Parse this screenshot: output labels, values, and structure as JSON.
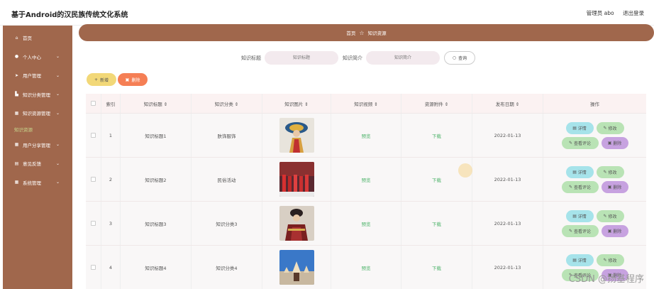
{
  "app": {
    "title": "基于Android的汉民族传统文化系统"
  },
  "user": {
    "role": "管理员 abo",
    "logout": "退出登录"
  },
  "sidebar": {
    "items": [
      {
        "label": "首页",
        "icon": "home-icon"
      },
      {
        "label": "个人中心",
        "icon": "user-icon",
        "chevron": "⌄"
      },
      {
        "label": "用户管理",
        "icon": "send-icon",
        "chevron": "⌄"
      },
      {
        "label": "知识分类管理",
        "icon": "chart-icon",
        "chevron": "⌄"
      },
      {
        "label": "知识资源管理",
        "icon": "grid-icon",
        "chevron": "⌄"
      },
      {
        "label": "知识资源",
        "icon": "",
        "active": true
      },
      {
        "label": "用户分享管理",
        "icon": "grid-icon",
        "chevron": "⌄"
      },
      {
        "label": "意见反馈",
        "icon": "doc-icon",
        "chevron": "⌄"
      },
      {
        "label": "系统管理",
        "icon": "grid-icon",
        "chevron": "⌄"
      }
    ]
  },
  "breadcrumb": {
    "home": "首页",
    "current": "知识资源"
  },
  "search": {
    "title_label": "知识标题",
    "title_placeholder": "知识标题",
    "intro_label": "知识简介",
    "intro_placeholder": "知识简介",
    "button": "查询"
  },
  "toolbar": {
    "add": "新增",
    "delete": "删除"
  },
  "table": {
    "headers": [
      "",
      "索引",
      "知识标题 ⇕",
      "知识分类 ⇕",
      "知识图片 ⇕",
      "知识视频 ⇕",
      "资源附件 ⇕",
      "发布日期 ⇕",
      "操作"
    ],
    "rows": [
      {
        "index": "1",
        "title": "知识标题1",
        "category": "肤饰服饰",
        "video": "预览",
        "attachment": "下载",
        "date": "2022-01-13",
        "ops": [
          "详情",
          "修改",
          "查看评论",
          "删除"
        ]
      },
      {
        "index": "2",
        "title": "知识标题2",
        "category": "民俗活动",
        "video": "预览",
        "attachment": "下载",
        "date": "2022-01-13",
        "ops": [
          "详情",
          "修改",
          "查看评论",
          "删除"
        ]
      },
      {
        "index": "3",
        "title": "知识标题3",
        "category": "知识分类3",
        "video": "预览",
        "attachment": "下载",
        "date": "2022-01-13",
        "ops": [
          "详情",
          "修改",
          "查看评论",
          "删除"
        ]
      },
      {
        "index": "4",
        "title": "知识标题4",
        "category": "知识分类4",
        "video": "预览",
        "attachment": "下载",
        "date": "2022-01-13",
        "ops": [
          "详情",
          "修改",
          "查看评论",
          "删除"
        ]
      }
    ]
  },
  "watermark": "CSDN @扬基程序",
  "colors": {
    "sidebar": "#a0674c",
    "accent_green": "#4db36a",
    "delete": "#f57f55",
    "add": "#f2d878"
  }
}
